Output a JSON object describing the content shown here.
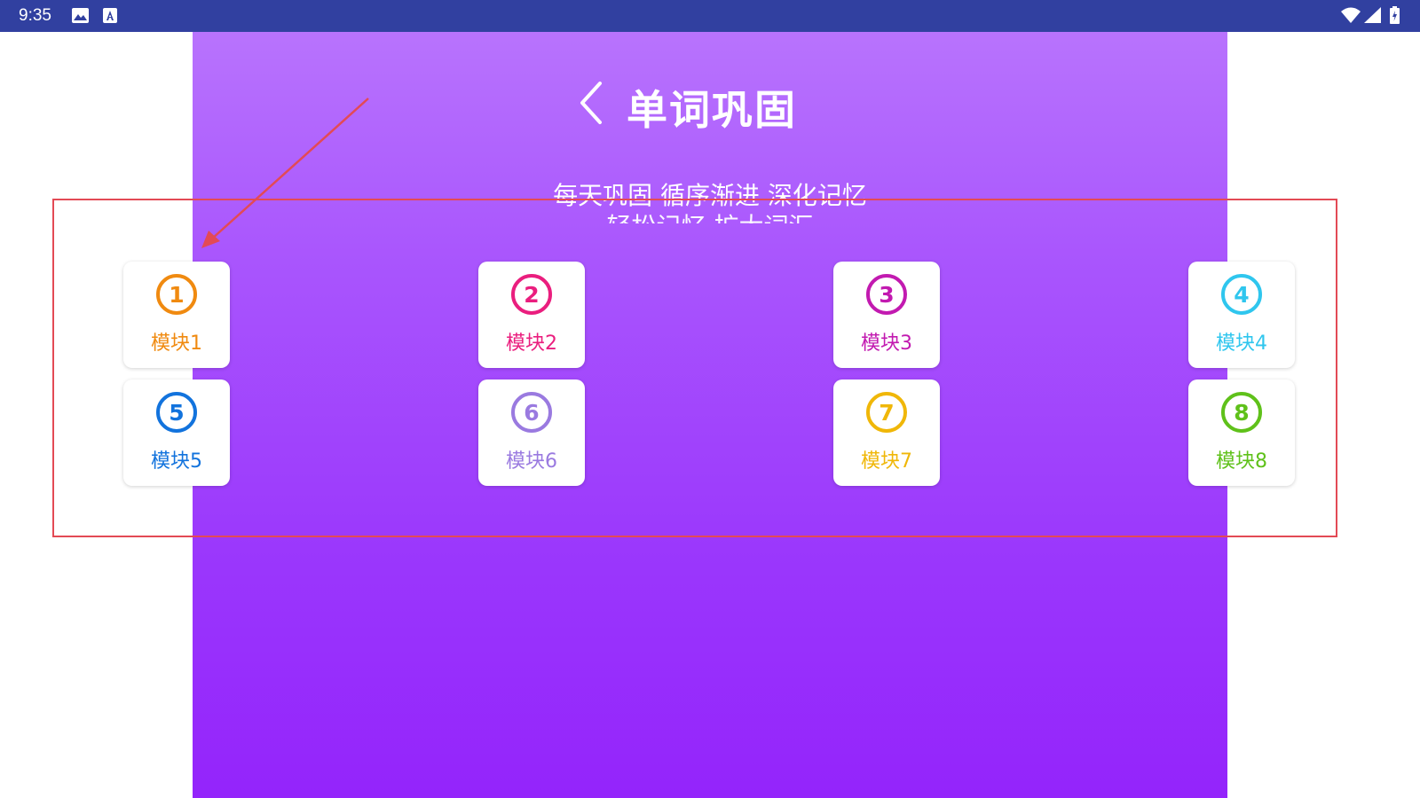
{
  "status_bar": {
    "time": "9:35",
    "icons": [
      "image-icon",
      "a-text-icon",
      "wifi-icon",
      "cell-signal-icon",
      "battery-icon"
    ],
    "background": "#3140a0"
  },
  "header": {
    "title": "单词巩固",
    "back_icon": "chevron-left-icon"
  },
  "taglines": [
    "每天巩固 循序渐进 深化记忆",
    "轻松记忆 扩大词汇"
  ],
  "theme": {
    "gradient_top": "#b873fd",
    "gradient_bottom": "#9424fb",
    "annotation_color": "#e34a55"
  },
  "modules": [
    {
      "number": "1",
      "label": "模块1",
      "color": "#f08a10"
    },
    {
      "number": "2",
      "label": "模块2",
      "color": "#ea1e7e"
    },
    {
      "number": "3",
      "label": "模块3",
      "color": "#c21ab0"
    },
    {
      "number": "4",
      "label": "模块4",
      "color": "#2fc6ee"
    },
    {
      "number": "5",
      "label": "模块5",
      "color": "#1273dd"
    },
    {
      "number": "6",
      "label": "模块6",
      "color": "#9a7ae0"
    },
    {
      "number": "7",
      "label": "模块7",
      "color": "#f0b708"
    },
    {
      "number": "8",
      "label": "模块8",
      "color": "#5fc11a"
    }
  ]
}
